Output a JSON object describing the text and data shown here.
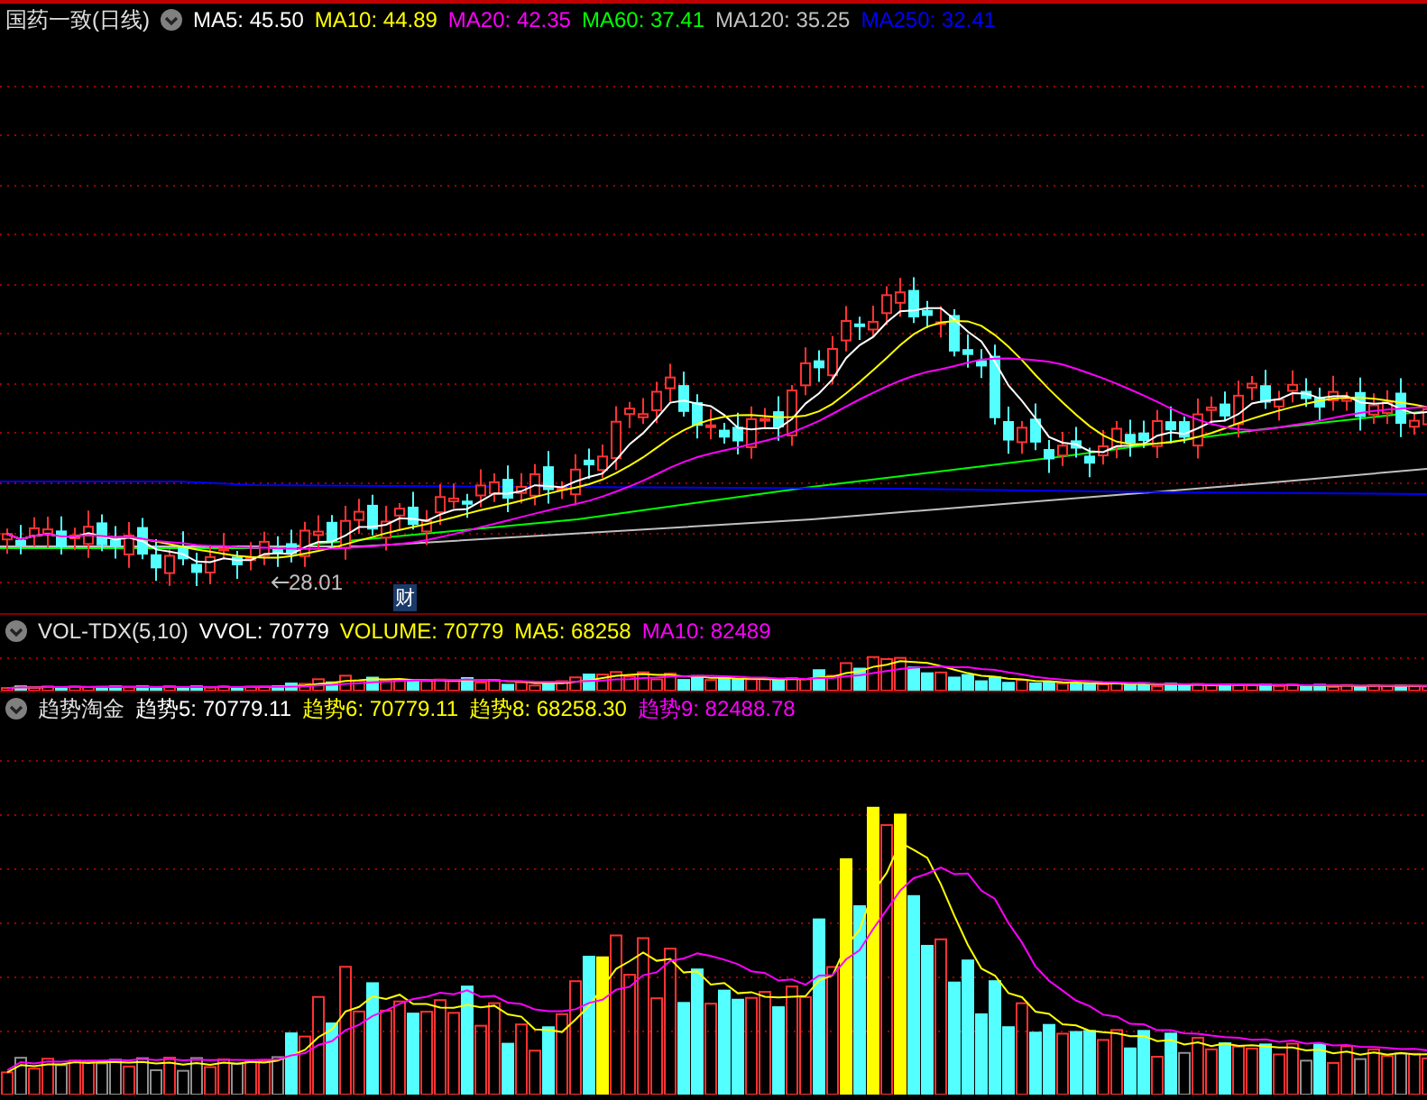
{
  "main_panel": {
    "title": "国药一致(日线)",
    "indicators": [
      {
        "text": "MA5: 45.50",
        "color": "#ffffff"
      },
      {
        "text": "MA10: 44.89",
        "color": "#ffff00"
      },
      {
        "text": "MA20: 42.35",
        "color": "#ff00ff"
      },
      {
        "text": "MA60: 37.41",
        "color": "#00ff00"
      },
      {
        "text": "MA120: 35.25",
        "color": "#c0c0c0"
      },
      {
        "text": "MA250: 32.41",
        "color": "#0000ff"
      }
    ],
    "low_marker": "28.01",
    "finance_badge": "财"
  },
  "volume_panel": {
    "title": "VOL-TDX(5,10)",
    "indicators": [
      {
        "text": "VVOL: 70779",
        "color": "#ffffff"
      },
      {
        "text": "VOLUME: 70779",
        "color": "#ffff00"
      },
      {
        "text": "MA5: 68258",
        "color": "#ffff00"
      },
      {
        "text": "MA10: 82489",
        "color": "#ff00ff"
      }
    ]
  },
  "trend_panel": {
    "title": "趋势淘金",
    "indicators": [
      {
        "text": "趋势5: 70779.11",
        "color": "#ffffff"
      },
      {
        "text": "趋势6: 70779.11",
        "color": "#ffff00"
      },
      {
        "text": "趋势8: 68258.30",
        "color": "#ffff00"
      },
      {
        "text": "趋势9: 82488.78",
        "color": "#ff00ff"
      }
    ]
  }
}
